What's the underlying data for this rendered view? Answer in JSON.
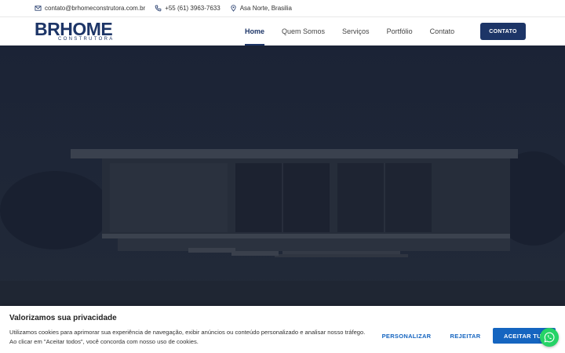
{
  "topbar": {
    "email": "contato@brhomeconstrutora.com.br",
    "phone": "+55 (61) 3963-7633",
    "location": "Asa Norte, Brasilia"
  },
  "logo": {
    "main_br": "BR",
    "main_home": "HOME",
    "sub": "CONSTRUTORA"
  },
  "nav": {
    "items": [
      "Home",
      "Quem Somos",
      "Serviços",
      "Portfólio",
      "Contato"
    ],
    "active": "Home",
    "cta": "CONTATO"
  },
  "cookie": {
    "title": "Valorizamos sua privacidade",
    "text": "Utilizamos cookies para aprimorar sua experiência de navegação, exibir anúncios ou conteúdo personalizado e analisar nosso tráfego. Ao clicar em \"Aceitar todos\", você concorda com nosso uso de cookies.",
    "customize": "PERSONALIZAR",
    "reject": "REJEITAR",
    "accept": "ACEITAR TUDO"
  },
  "colors": {
    "brand": "#1d3567",
    "accent": "#1565c0",
    "whatsapp": "#25d366"
  },
  "icons": [
    "envelope-icon",
    "phone-icon",
    "location-pin-icon",
    "whatsapp-icon"
  ]
}
